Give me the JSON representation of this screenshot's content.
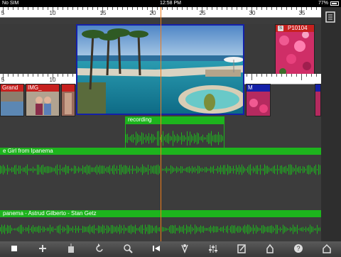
{
  "status_bar": {
    "carrier": "No SIM",
    "time": "12:58 PM",
    "battery": "77%"
  },
  "ruler_top": {
    "labels": [
      "5",
      "10",
      "15",
      "20",
      "25",
      "30",
      "35"
    ]
  },
  "ruler_bottom": {
    "labels": [
      "5",
      "10"
    ]
  },
  "video_track_1": {
    "clips": [
      {
        "title": ""
      },
      {
        "title": "P10104"
      }
    ]
  },
  "video_track_2": {
    "clips": [
      {
        "title": "Grand"
      },
      {
        "title": "IMG_"
      },
      {
        "title": ""
      },
      {
        "title": "M"
      }
    ]
  },
  "audio_tracks": [
    {
      "title": "recording"
    },
    {
      "title": "e Girl from Ipanema"
    },
    {
      "title": "panema - Astrud Gilberto - Stan Getz"
    }
  ],
  "colors": {
    "accent_green": "#1db41d",
    "playhead": "#f07b1a",
    "selection_blue": "#1420a8"
  },
  "toolbar": {
    "icons": [
      "stop-icon",
      "add-icon",
      "import-icon",
      "undo-icon",
      "zoom-icon",
      "rewind-to-start-icon",
      "microphone-icon",
      "mixer-icon",
      "edit-icon",
      "share-icon",
      "help-icon",
      "home-icon"
    ]
  }
}
